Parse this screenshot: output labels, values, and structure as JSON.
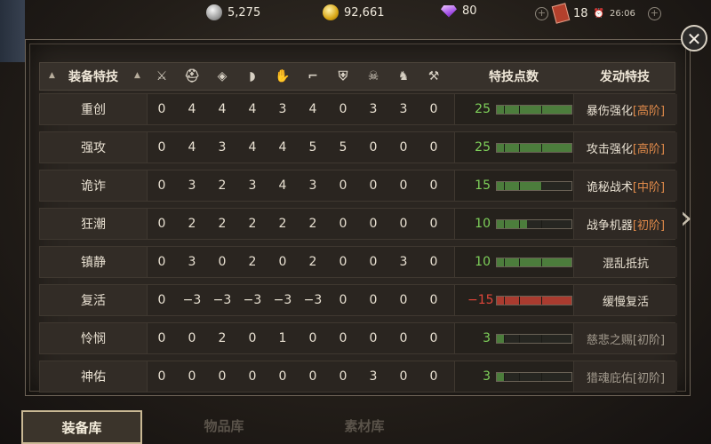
{
  "resources": {
    "silver": "5,275",
    "gold": "92,661",
    "diamonds": "80",
    "tickets": "18",
    "timer": "26:06"
  },
  "table": {
    "header_label": "装备特技",
    "header_points": "特技点数",
    "header_activate": "发动特技",
    "column_icons": [
      "sword-icon",
      "helmet-icon",
      "armor-icon",
      "pauldron-icon",
      "gauntlet-icon",
      "boots-icon",
      "shield-icon",
      "demon-mask-icon",
      "horse-icon",
      "tool-icon"
    ],
    "rows": [
      {
        "name": "重创",
        "values": [
          "0",
          "4",
          "4",
          "4",
          "3",
          "4",
          "0",
          "3",
          "3",
          "0"
        ],
        "points": "25",
        "points_fraction": 1.0,
        "points_color": "#7ed05a",
        "activate": "暴伤强化",
        "tier": "[高阶]",
        "dim": false
      },
      {
        "name": "强攻",
        "values": [
          "0",
          "4",
          "3",
          "4",
          "4",
          "5",
          "5",
          "0",
          "0",
          "0"
        ],
        "points": "25",
        "points_fraction": 1.0,
        "points_color": "#7ed05a",
        "activate": "攻击强化",
        "tier": "[高阶]",
        "dim": false
      },
      {
        "name": "诡诈",
        "values": [
          "0",
          "3",
          "2",
          "3",
          "4",
          "3",
          "0",
          "0",
          "0",
          "0"
        ],
        "points": "15",
        "points_fraction": 0.6,
        "points_color": "#7ed05a",
        "activate": "诡秘战术",
        "tier": "[中阶]",
        "dim": false
      },
      {
        "name": "狂潮",
        "values": [
          "0",
          "2",
          "2",
          "2",
          "2",
          "2",
          "0",
          "0",
          "0",
          "0"
        ],
        "points": "10",
        "points_fraction": 0.4,
        "points_color": "#7ed05a",
        "activate": "战争机器",
        "tier": "[初阶]",
        "dim": false
      },
      {
        "name": "镇静",
        "values": [
          "0",
          "3",
          "0",
          "2",
          "0",
          "2",
          "0",
          "0",
          "3",
          "0"
        ],
        "points": "10",
        "points_fraction": 1.0,
        "points_color": "#7ed05a",
        "activate": "混乱抵抗",
        "tier": "",
        "dim": false
      },
      {
        "name": "复活",
        "values": [
          "0",
          "−3",
          "−3",
          "−3",
          "−3",
          "−3",
          "0",
          "0",
          "0",
          "0"
        ],
        "points": "−15",
        "points_fraction": 1.0,
        "points_color": "#e0463a",
        "activate": "缓慢复活",
        "tier": "",
        "dim": false,
        "negative": true
      },
      {
        "name": "怜悯",
        "values": [
          "0",
          "0",
          "2",
          "0",
          "1",
          "0",
          "0",
          "0",
          "0",
          "0"
        ],
        "points": "3",
        "points_fraction": 0.1,
        "points_color": "#7ed05a",
        "activate": "慈悲之赐",
        "tier": "[初阶]",
        "dim": true
      },
      {
        "name": "神佑",
        "values": [
          "0",
          "0",
          "0",
          "0",
          "0",
          "0",
          "0",
          "3",
          "0",
          "0"
        ],
        "points": "3",
        "points_fraction": 0.1,
        "points_color": "#7ed05a",
        "activate": "猎魂庇佑",
        "tier": "[初阶]",
        "dim": true
      }
    ]
  },
  "tabs": {
    "equipment": "装备库",
    "items": "物品库",
    "materials": "素材库"
  }
}
